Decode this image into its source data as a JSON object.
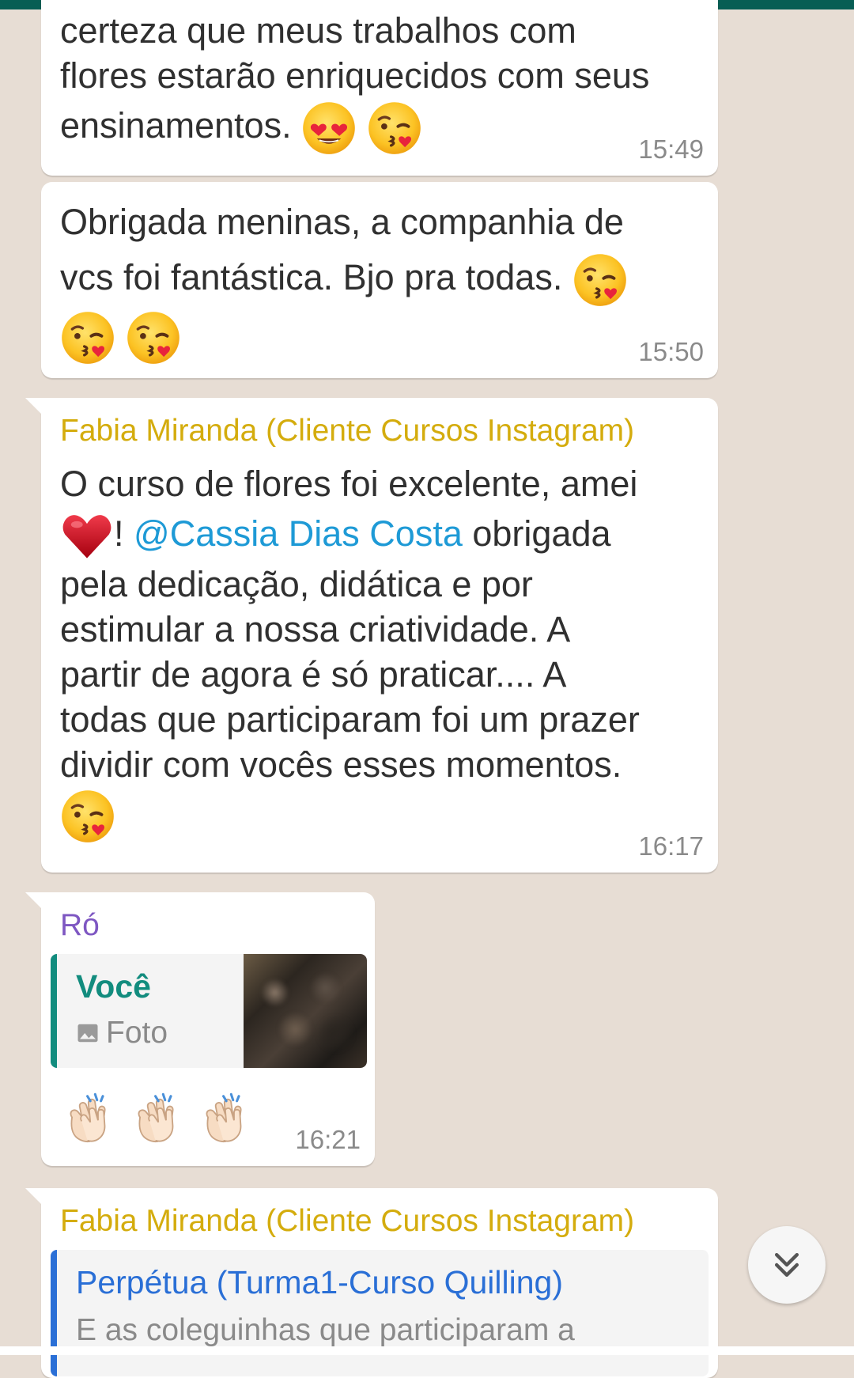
{
  "messages": [
    {
      "id": "m1",
      "lines": [
        "certeza que meus trabalhos com",
        "flores estarão enriquecidos com seus",
        "ensinamentos."
      ],
      "emojis": [
        "heart-eyes-emoji",
        "kiss-emoji"
      ],
      "time": "15:49"
    },
    {
      "id": "m2",
      "lines": [
        "Obrigada meninas,  a companhia de",
        "vcs foi fantástica. Bjo pra todas."
      ],
      "emojis": [
        "kiss-emoji",
        "kiss-emoji",
        "kiss-emoji"
      ],
      "time": "15:50"
    },
    {
      "id": "m3",
      "sender": "Fabia Miranda (Cliente Cursos Instagram)",
      "sender_color": "#d4ac0d",
      "line1": "O curso de flores foi excelente, amei",
      "after_heart": "!",
      "mention": "@Cassia Dias Costa",
      "after_mention": " obrigada",
      "lines_rest": [
        "pela dedicação, didática e por",
        "estimular a nossa criatividade.  A",
        "partir de agora é só praticar.... A",
        "todas que participaram foi um prazer",
        "dividir com vocês esses momentos."
      ],
      "time": "16:17"
    },
    {
      "id": "m4",
      "sender": "Ró",
      "sender_color": "#7e57c2",
      "quote_author": "Você",
      "quote_author_color": "#128c7e",
      "quote_text": "Foto",
      "time": "16:21"
    },
    {
      "id": "m5",
      "sender": "Fabia Miranda (Cliente Cursos Instagram)",
      "sender_color": "#d4ac0d",
      "quote_author": "Perpétua (Turma1-Curso Quilling)",
      "quote_author_color": "#2a6fd6",
      "quote_text": "E as coleguinhas que participaram a"
    }
  ],
  "scroll_button_icon": "double-chevron-down-icon"
}
